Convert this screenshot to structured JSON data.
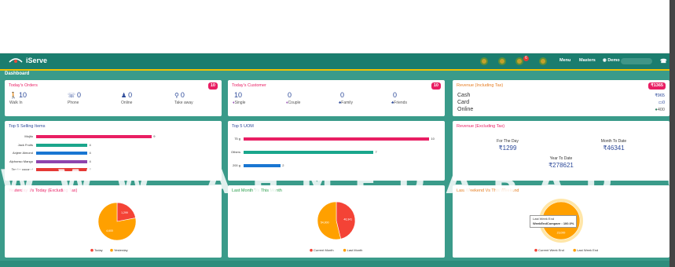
{
  "app": {
    "name": "iServe"
  },
  "nav": {
    "menu": "Menu",
    "masters": "Masters",
    "user": "Demo",
    "notification_count": "6"
  },
  "page": {
    "title": "Dashboard"
  },
  "orders": {
    "title": "Today's Orders",
    "badge": "10",
    "stats": [
      {
        "value": "10",
        "label": "Walk In",
        "icon": "walk-icon"
      },
      {
        "value": "0",
        "label": "Phone",
        "icon": "phone-icon"
      },
      {
        "value": "0",
        "label": "Online",
        "icon": "android-icon"
      },
      {
        "value": "0",
        "label": "Take away",
        "icon": "bike-icon"
      }
    ]
  },
  "customers": {
    "title": "Today's Customer",
    "badge": "10",
    "stats": [
      {
        "value": "10",
        "label": "Single",
        "icon": "person-icon"
      },
      {
        "value": "0",
        "label": "Couple",
        "icon": "couple-icon"
      },
      {
        "value": "0",
        "label": "Family",
        "icon": "family-icon"
      },
      {
        "value": "0",
        "label": "Friends",
        "icon": "friends-icon"
      }
    ]
  },
  "revenue_incl": {
    "title": "Revenue (Including Tax)",
    "badge": "₹1365",
    "rows": [
      {
        "label": "Cash",
        "value": "₹965"
      },
      {
        "label": "Card",
        "value": "0"
      },
      {
        "label": "Online",
        "value": "400"
      }
    ]
  },
  "top_items": {
    "title": "Top 5 Selling Items",
    "bars": [
      {
        "label": "Mojito",
        "value": 9,
        "color": "#e91e63"
      },
      {
        "label": "Jack Fruits",
        "value": 4,
        "color": "#1aa68c"
      },
      {
        "label": "Anjeer Almond",
        "value": 4,
        "color": "#1976d2"
      },
      {
        "label": "Alphonso Mango",
        "value": 4,
        "color": "#8e44ad"
      },
      {
        "label": "Tender coconut",
        "value": 4,
        "color": "#e53935"
      }
    ],
    "max": 11
  },
  "top_uom": {
    "title": "Top 5 UOM",
    "bars": [
      {
        "label": "75 g",
        "value": 10,
        "color": "#e91e63"
      },
      {
        "label": "Others",
        "value": 7,
        "color": "#1aa68c"
      },
      {
        "label": "200 g",
        "value": 2,
        "color": "#1976d2"
      }
    ],
    "max": 11
  },
  "revenue_excl": {
    "title": "Revenue (Excluding Tax)",
    "for_day_label": "For The Day",
    "for_day_value": "₹1299",
    "month_label": "Month To Date",
    "month_value": "₹46341",
    "year_label": "Year To Date",
    "year_value": "₹278621"
  },
  "pie1": {
    "title": "Yesterday Vs Today (Excluding Tax)",
    "slices": [
      {
        "name": "Today",
        "value": 1299,
        "label": "1,299",
        "color": "#f44336"
      },
      {
        "name": "Yesterday",
        "value": 4600,
        "label": "4,600",
        "color": "#ffa000"
      }
    ]
  },
  "pie2": {
    "title": "Last Month Vs This Month",
    "slices": [
      {
        "name": "Current Month",
        "value": 46341,
        "label": "46,341",
        "color": "#f44336"
      },
      {
        "name": "Last Month",
        "value": 54000,
        "label": "54,000",
        "color": "#ffa000"
      }
    ]
  },
  "pie3": {
    "title": "Last Weekend Vs This Weekend",
    "tooltip_title": "Last Week End",
    "tooltip_row": "WeekEndCompare : 100.0%",
    "slices": [
      {
        "name": "Current Week End",
        "value": 0,
        "label": "",
        "color": "#f44336"
      },
      {
        "name": "Last Week End",
        "value": 100,
        "label": "23,000",
        "color": "#ffa000"
      }
    ]
  },
  "watermark": "W  W  W  .  A  H  M  E  D  A  B  A  D  .  C  O  M",
  "colors": {
    "navbar": "#1b7d6e",
    "strip": "#3a9b8a",
    "accent": "#e91e63"
  }
}
